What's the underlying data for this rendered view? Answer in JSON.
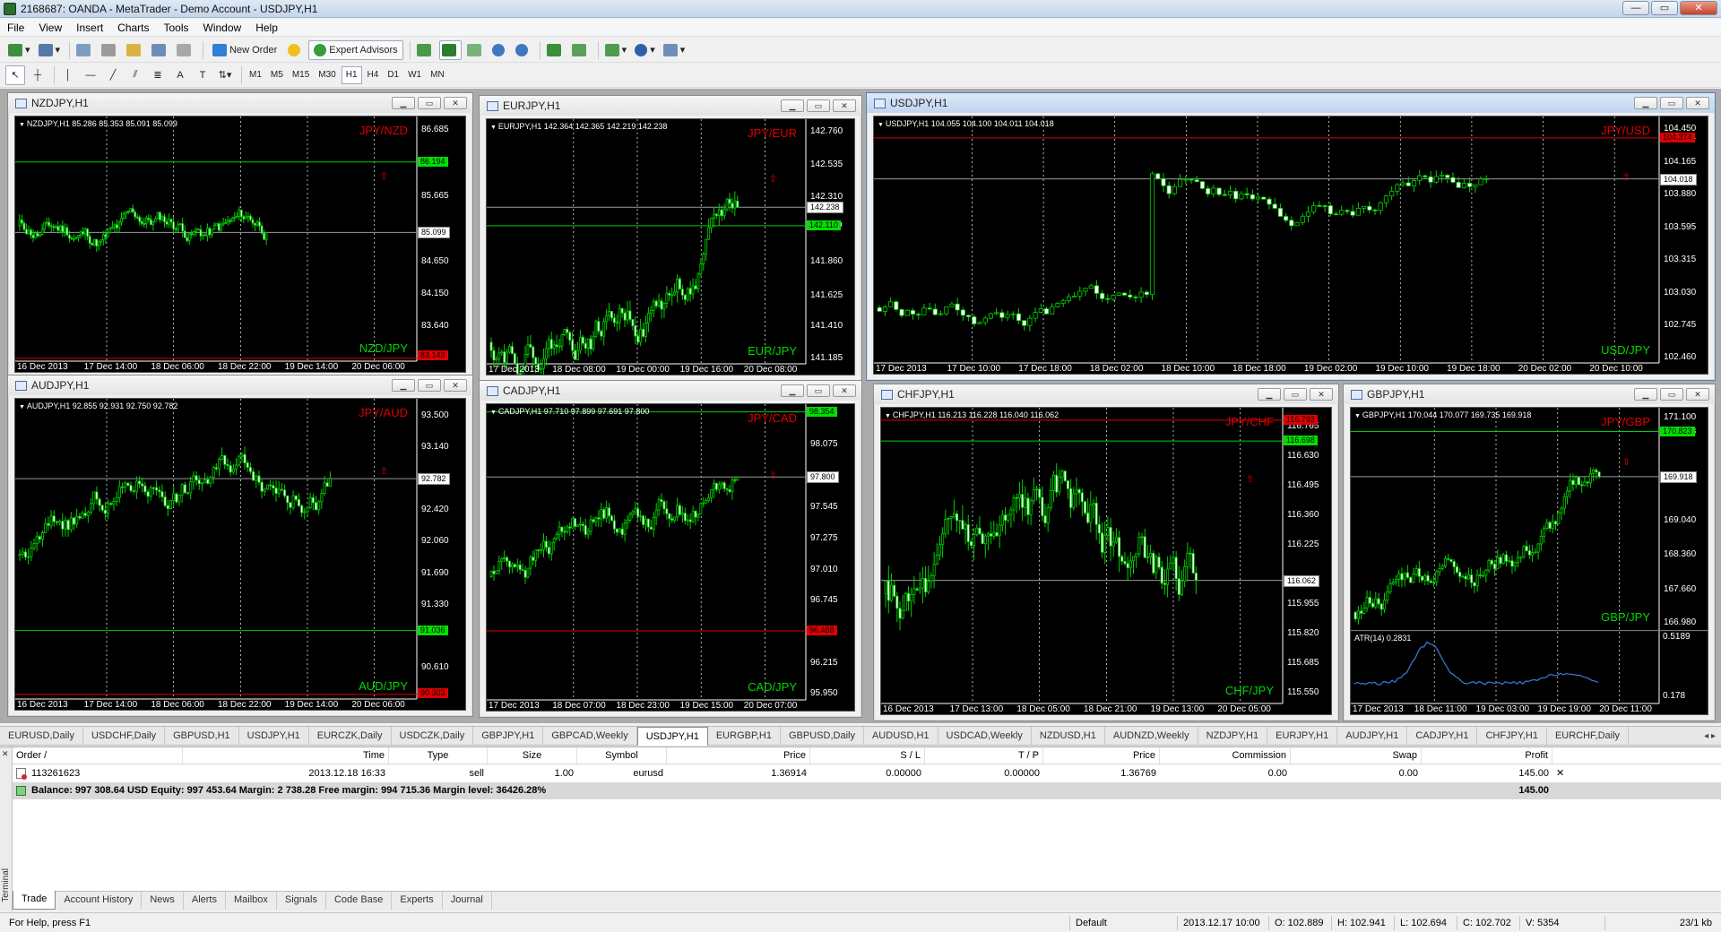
{
  "window": {
    "title": "2168687: OANDA - MetaTrader - Demo Account - USDJPY,H1"
  },
  "menu": [
    "File",
    "View",
    "Insert",
    "Charts",
    "Tools",
    "Window",
    "Help"
  ],
  "toolbar": {
    "new_order": "New Order",
    "expert_advisors": "Expert Advisors",
    "timeframes": [
      "M1",
      "M5",
      "M15",
      "M30",
      "H1",
      "H4",
      "D1",
      "W1",
      "MN"
    ],
    "active_tf": "H1"
  },
  "charts": [
    {
      "id": "nzdjpy",
      "title": "NZDJPY,H1",
      "ohlc": "NZDJPY,H1  85.286 85.353 85.091 85.099",
      "top_label": "JPY/NZD",
      "bottom_label": "NZD/JPY",
      "y_ticks": [
        "86.685",
        "86.194",
        "85.665",
        "85.099",
        "84.650",
        "84.150",
        "83.640",
        "83.143"
      ],
      "x_ticks": [
        "16 Dec 2013",
        "17 Dec 14:00",
        "18 Dec 06:00",
        "18 Dec 22:00",
        "19 Dec 14:00",
        "20 Dec 06:00"
      ],
      "price_boxes": [
        {
          "v": "86.194",
          "c": "g"
        },
        {
          "v": "85.099",
          "c": "w"
        },
        {
          "v": "83.143",
          "c": "r"
        }
      ],
      "ylim": [
        83.1,
        86.9
      ],
      "h_lines": [
        {
          "v": 86.194,
          "c": "#00d000"
        },
        {
          "v": 85.099,
          "c": "#9a9a9a"
        },
        {
          "v": 83.143,
          "c": "#e00000"
        }
      ],
      "seed": 11,
      "start": 85.2,
      "end": 85.099,
      "vol": 0.12,
      "n": 110,
      "fill": 0.62,
      "bias": 0.002
    },
    {
      "id": "eurjpy",
      "title": "EURJPY,H1",
      "ohlc": "EURJPY,H1  142.364 142.365 142.219 142.238",
      "top_label": "JPY/EUR",
      "bottom_label": "EUR/JPY",
      "y_ticks": [
        "142.760",
        "142.535",
        "142.310",
        "142.238",
        "142.110",
        "141.860",
        "141.625",
        "141.410",
        "141.185"
      ],
      "x_ticks": [
        "17 Dec 2013",
        "18 Dec 08:00",
        "19 Dec 00:00",
        "19 Dec 16:00",
        "20 Dec 08:00"
      ],
      "price_boxes": [
        {
          "v": "142.238",
          "c": "w"
        },
        {
          "v": "142.110",
          "c": "g"
        }
      ],
      "ylim": [
        141.15,
        142.85
      ],
      "h_lines": [
        {
          "v": 142.238,
          "c": "#9a9a9a"
        },
        {
          "v": 142.11,
          "c": "#00d000"
        }
      ],
      "seed": 22,
      "start": 141.3,
      "end": 142.238,
      "vol": 0.09,
      "n": 95,
      "fill": 0.78,
      "bias": 0.01
    },
    {
      "id": "usdjpy",
      "title": "USDJPY,H1",
      "ohlc": "USDJPY,H1  104.055 104.100 104.011 104.018",
      "top_label": "JPY/USD",
      "bottom_label": "USD/JPY",
      "y_ticks": [
        "104.450",
        "104.374",
        "104.165",
        "104.018",
        "103.880",
        "103.595",
        "103.315",
        "103.030",
        "102.745",
        "102.460"
      ],
      "x_ticks": [
        "17 Dec 2013",
        "17 Dec 10:00",
        "17 Dec 18:00",
        "18 Dec 02:00",
        "18 Dec 10:00",
        "18 Dec 18:00",
        "19 Dec 02:00",
        "19 Dec 10:00",
        "19 Dec 18:00",
        "20 Dec 02:00",
        "20 Dec 10:00"
      ],
      "price_boxes": [
        {
          "v": "104.374",
          "c": "r"
        },
        {
          "v": "104.018",
          "c": "w"
        }
      ],
      "ylim": [
        102.42,
        104.56
      ],
      "h_lines": [
        {
          "v": 104.374,
          "c": "#e00000"
        },
        {
          "v": 104.018,
          "c": "#9a9a9a"
        }
      ],
      "seed": 33,
      "start": 102.9,
      "end": 104.018,
      "vol": 0.07,
      "n": 110,
      "fill": 0.78,
      "bias": 0.0,
      "jump": [
        49,
        1.1
      ]
    },
    {
      "id": "audjpy",
      "title": "AUDJPY,H1",
      "ohlc": "AUDJPY,H1  92.855 92.931 92.750 92.782",
      "top_label": "JPY/AUD",
      "bottom_label": "AUD/JPY",
      "y_ticks": [
        "93.500",
        "93.140",
        "92.782",
        "92.420",
        "92.060",
        "91.690",
        "91.330",
        "91.036",
        "90.610",
        "90.303"
      ],
      "x_ticks": [
        "16 Dec 2013",
        "17 Dec 14:00",
        "18 Dec 06:00",
        "18 Dec 22:00",
        "19 Dec 14:00",
        "20 Dec 06:00"
      ],
      "price_boxes": [
        {
          "v": "92.782",
          "c": "w"
        },
        {
          "v": "91.036",
          "c": "g"
        },
        {
          "v": "90.303",
          "c": "r"
        }
      ],
      "ylim": [
        90.25,
        93.7
      ],
      "h_lines": [
        {
          "v": 92.782,
          "c": "#9a9a9a"
        },
        {
          "v": 91.036,
          "c": "#00d000"
        },
        {
          "v": 90.303,
          "c": "#e00000"
        }
      ],
      "seed": 44,
      "start": 91.9,
      "end": 92.782,
      "vol": 0.12,
      "n": 110,
      "fill": 0.78,
      "bias": 0.006
    },
    {
      "id": "cadjpy",
      "title": "CADJPY,H1",
      "ohlc": "CADJPY,H1  97.710 97.899 97.691 97.800",
      "top_label": "JPY/CAD",
      "bottom_label": "CAD/JPY",
      "y_ticks": [
        "98.354",
        "98.075",
        "97.800",
        "97.545",
        "97.275",
        "97.010",
        "96.745",
        "96.488",
        "96.215",
        "95.950"
      ],
      "x_ticks": [
        "17 Dec 2013",
        "18 Dec 07:00",
        "18 Dec 23:00",
        "19 Dec 15:00",
        "20 Dec 07:00"
      ],
      "price_boxes": [
        {
          "v": "98.354",
          "c": "g"
        },
        {
          "v": "97.800",
          "c": "w"
        },
        {
          "v": "96.488",
          "c": "r"
        }
      ],
      "ylim": [
        95.9,
        98.42
      ],
      "h_lines": [
        {
          "v": 98.354,
          "c": "#00d000"
        },
        {
          "v": 97.8,
          "c": "#9a9a9a"
        },
        {
          "v": 96.488,
          "c": "#e00000"
        }
      ],
      "seed": 55,
      "start": 96.95,
      "end": 97.8,
      "vol": 0.09,
      "n": 95,
      "fill": 0.78,
      "bias": 0.006
    },
    {
      "id": "chfjpy",
      "title": "CHFJPY,H1",
      "ohlc": "CHFJPY,H1  116.213 116.228 116.040 116.062",
      "top_label": "JPY/CHF",
      "bottom_label": "CHF/JPY",
      "y_ticks": [
        "116.765",
        "116.630",
        "116.495",
        "116.360",
        "116.225",
        "116.062",
        "115.955",
        "115.820",
        "115.685",
        "115.550"
      ],
      "x_ticks": [
        "16 Dec 2013",
        "17 Dec 13:00",
        "18 Dec 05:00",
        "18 Dec 21:00",
        "19 Dec 13:00",
        "20 Dec 05:00"
      ],
      "price_boxes": [
        {
          "v": "116.793",
          "c": "r"
        },
        {
          "v": "116.698",
          "c": "g"
        },
        {
          "v": "116.062",
          "c": "w"
        }
      ],
      "ylim": [
        115.5,
        116.85
      ],
      "h_lines": [
        {
          "v": 116.793,
          "c": "#e00000"
        },
        {
          "v": 116.698,
          "c": "#00d000"
        },
        {
          "v": 116.062,
          "c": "#9a9a9a"
        }
      ],
      "seed": 66,
      "start": 116.0,
      "end": 116.062,
      "vol": 0.09,
      "n": 110,
      "fill": 0.78,
      "bias": 0.0
    },
    {
      "id": "gbpjpy",
      "title": "GBPJPY,H1",
      "ohlc": "GBPJPY,H1  170.044 170.077 169.735 169.918",
      "top_label": "JPY/GBP",
      "bottom_label": "GBP/JPY",
      "y_ticks": [
        "171.100",
        "170.823",
        "169.918",
        "169.040",
        "168.360",
        "167.660",
        "166.980"
      ],
      "x_ticks": [
        "17 Dec 2013",
        "18 Dec 11:00",
        "19 Dec 03:00",
        "19 Dec 19:00",
        "20 Dec 11:00"
      ],
      "price_boxes": [
        {
          "v": "170.823",
          "c": "g"
        },
        {
          "v": "169.918",
          "c": "w"
        }
      ],
      "ylim": [
        166.85,
        171.3
      ],
      "h_lines": [
        {
          "v": 170.823,
          "c": "#00d000"
        },
        {
          "v": 169.918,
          "c": "#9a9a9a"
        }
      ],
      "seed": 77,
      "start": 167.2,
      "end": 169.918,
      "vol": 0.2,
      "n": 85,
      "fill": 0.8,
      "bias": 0.03,
      "indicator": {
        "label": "ATR(14) 0.2831",
        "ticks": [
          "0.5189",
          "0.178"
        ]
      }
    }
  ],
  "chart_tabs": [
    "EURUSD,Daily",
    "USDCHF,Daily",
    "GBPUSD,H1",
    "USDJPY,H1",
    "EURCZK,Daily",
    "USDCZK,Daily",
    "GBPJPY,H1",
    "GBPCAD,Weekly",
    "USDJPY,H1",
    "EURGBP,H1",
    "GBPUSD,Daily",
    "AUDUSD,H1",
    "USDCAD,Weekly",
    "NZDUSD,H1",
    "AUDNZD,Weekly",
    "NZDJPY,H1",
    "EURJPY,H1",
    "AUDJPY,H1",
    "CADJPY,H1",
    "CHFJPY,H1",
    "EURCHF,Daily"
  ],
  "active_chart_tab": 8,
  "terminal": {
    "side_label": "Terminal",
    "columns": [
      "Order  /",
      "Time",
      "Type",
      "Size",
      "Symbol",
      "Price",
      "S / L",
      "T / P",
      "Price",
      "Commission",
      "Swap",
      "Profit"
    ],
    "order": {
      "order": "113261623",
      "time": "2013.12.18 16:33",
      "type": "sell",
      "size": "1.00",
      "symbol": "eurusd",
      "price": "1.36914",
      "sl": "0.00000",
      "tp": "0.00000",
      "cur_price": "1.36769",
      "commission": "0.00",
      "swap": "0.00",
      "profit": "145.00"
    },
    "balance": {
      "text": "Balance: 997 308.64 USD  Equity: 997 453.64  Margin: 2 738.28  Free margin: 994 715.36  Margin level: 36426.28%",
      "profit": "145.00"
    },
    "tabs": [
      "Trade",
      "Account History",
      "News",
      "Alerts",
      "Mailbox",
      "Signals",
      "Code Base",
      "Experts",
      "Journal"
    ],
    "active_tab": "Trade"
  },
  "status": {
    "help": "For Help, press F1",
    "profile": "Default",
    "time": "2013.12.17 10:00",
    "open": "O: 102.889",
    "high": "H: 102.941",
    "low": "L: 102.694",
    "close": "C: 102.702",
    "volume": "V: 5354",
    "traffic": "23/1 kb"
  }
}
